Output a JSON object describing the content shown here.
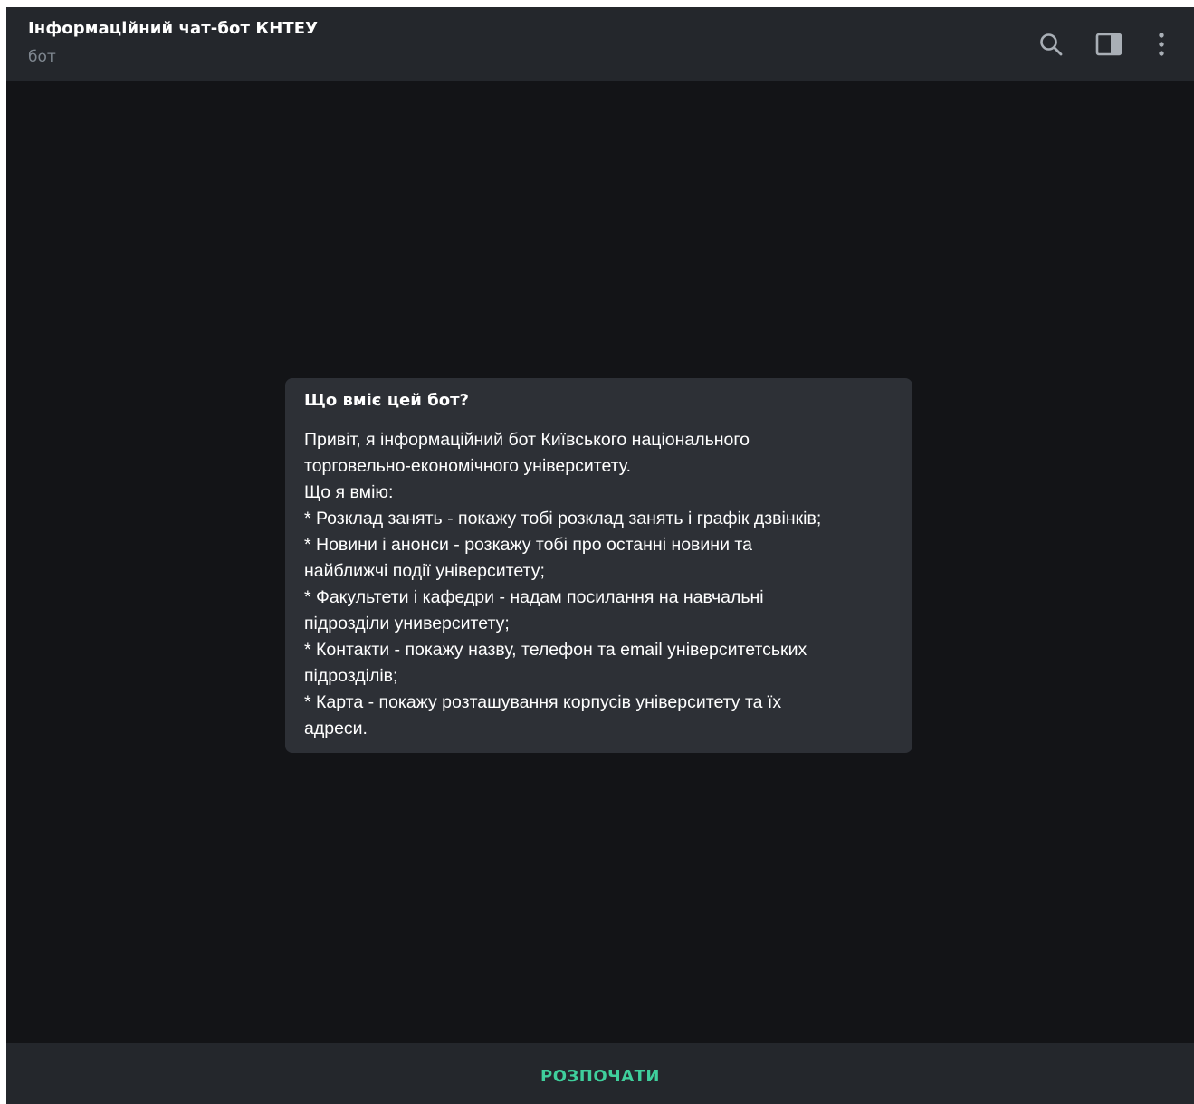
{
  "header": {
    "title": "Інформаційний чат-бот КНТЕУ",
    "subtitle": "бот",
    "icons": [
      "search-icon",
      "sidebar-toggle-icon",
      "more-vertical-icon"
    ]
  },
  "bot_info": {
    "title": "Що вміє цей бот?",
    "lines": [
      "Привіт, я інформаційний бот Київського національного",
      "торговельно-економічного університету.",
      "Що я вмію:",
      "* Розклад занять - покажу тобі розклад занять і графік дзвінків;",
      "* Новини і анонси - розкажу тобі про останні новини та",
      "найближчі події університету;",
      "* Факультети і кафедри - надам посилання на навчальні",
      "підрозділи униве­рситету;",
      "* Контакти - покажу назву, телефон та email університетських",
      "підрозділів;",
      "* Карта - покажу розташування корпусів університету та їх",
      "адреси."
    ]
  },
  "bottom": {
    "start_label": "РОЗПОЧАТИ"
  },
  "colors": {
    "chat_background": "#131417",
    "header_background": "#24272c",
    "card_background": "#2d3036",
    "accent": "#3fcf9c",
    "subtitle": "#7f8790"
  }
}
